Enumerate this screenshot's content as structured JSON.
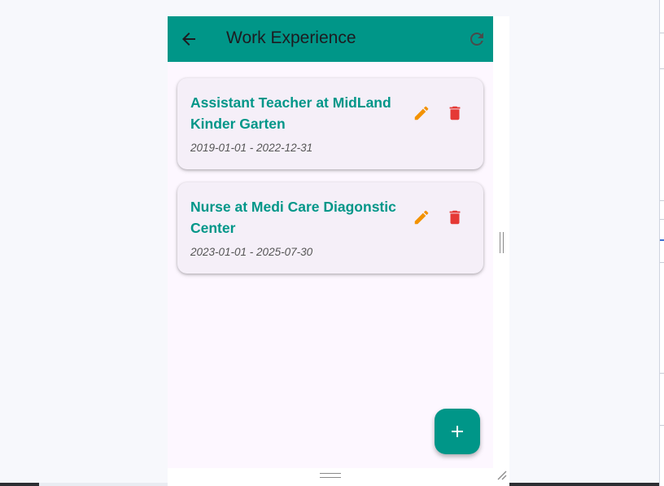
{
  "app_bar": {
    "title": "Work Experience",
    "back_icon": "arrow-left-icon",
    "refresh_icon": "refresh-icon",
    "color": "#009688"
  },
  "experiences": [
    {
      "title": "Assistant Teacher at MidLand Kinder Garten",
      "dates": "2019-01-01 - 2022-12-31",
      "edit_icon": "pencil-icon",
      "delete_icon": "trash-icon"
    },
    {
      "title": "Nurse at Medi Care Diagonstic Center",
      "dates": "2023-01-01 - 2025-07-30",
      "edit_icon": "pencil-icon",
      "delete_icon": "trash-icon"
    }
  ],
  "fab": {
    "icon": "plus-icon"
  },
  "colors": {
    "primary": "#009688",
    "edit": "#f39200",
    "delete": "#e53935",
    "background": "#fdf7ff",
    "card": "#f5eff8"
  }
}
